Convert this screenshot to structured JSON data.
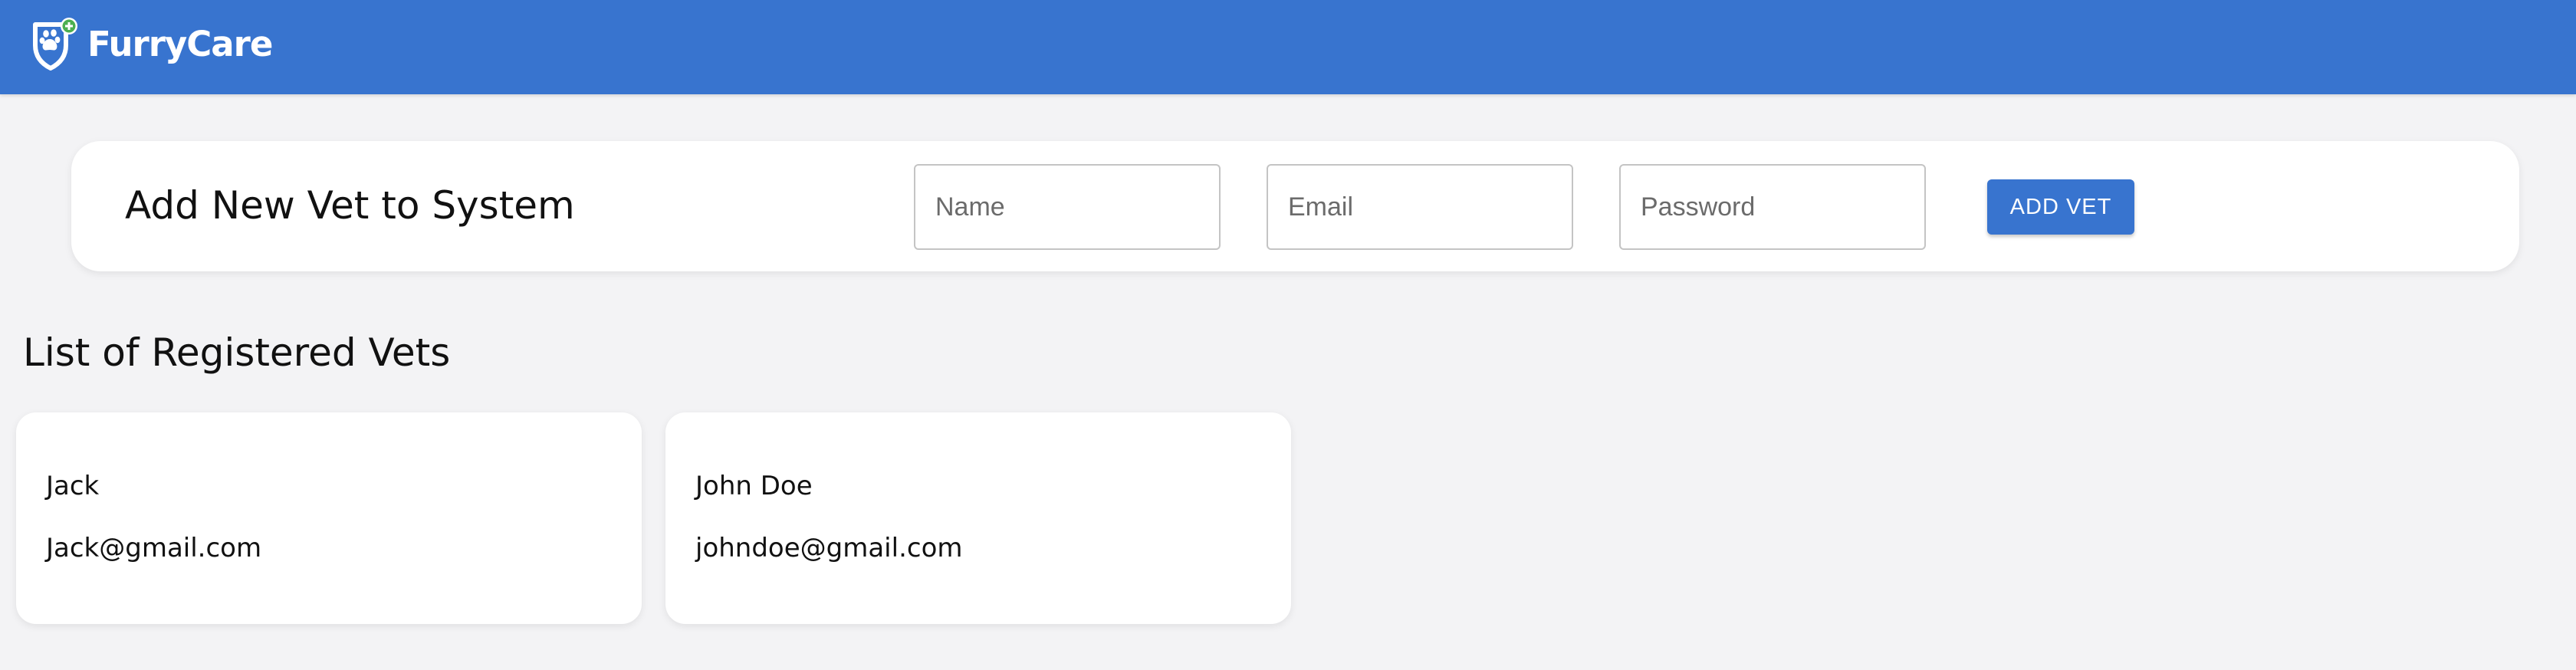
{
  "app": {
    "brand_name": "FurryCare",
    "logo_icon": "shield-paw-plus-icon"
  },
  "colors": {
    "primary": "#3874cf",
    "background": "#f3f3f5",
    "card": "#ffffff",
    "logo_plus": "#4caf50"
  },
  "add_vet_form": {
    "title": "Add New Vet to System",
    "name_placeholder": "Name",
    "email_placeholder": "Email",
    "password_placeholder": "Password",
    "submit_label": "ADD VET"
  },
  "vets_section": {
    "title": "List of Registered Vets",
    "vets": [
      {
        "name": "Jack",
        "email": "Jack@gmail.com"
      },
      {
        "name": "John Doe",
        "email": "johndoe@gmail.com"
      }
    ]
  }
}
